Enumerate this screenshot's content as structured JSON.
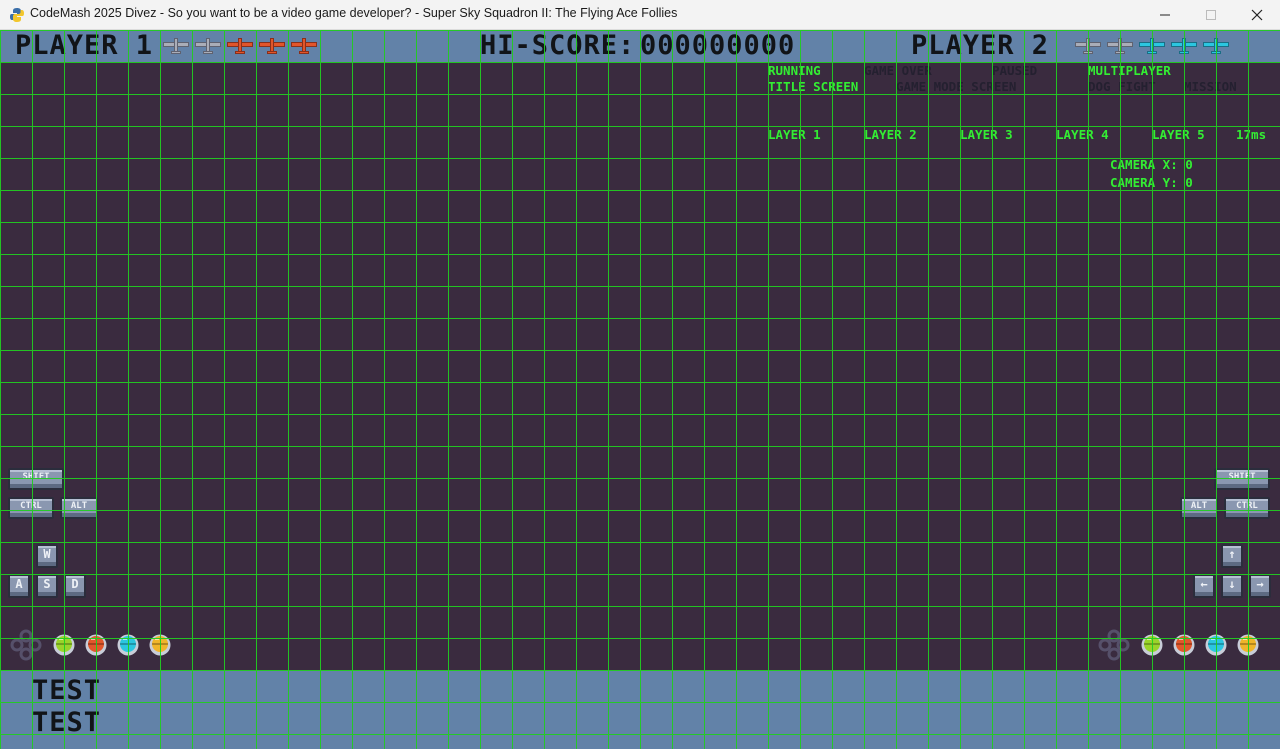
{
  "window": {
    "title": "CodeMash 2025 Divez - So you want to be a video game developer? - Super Sky Squadron II: The Flying Ace Follies"
  },
  "hud": {
    "player1_label": "PLAYER 1",
    "hiscore_label": "HI-SCORE:",
    "hiscore_value": "000000000",
    "player2_label": "PLAYER 2",
    "player1_lives": [
      "gray",
      "gray",
      "red",
      "red",
      "red"
    ],
    "player2_lives": [
      "gray",
      "gray",
      "cyan",
      "cyan",
      "cyan"
    ]
  },
  "debug": {
    "states": [
      {
        "label": "RUNNING",
        "active": true
      },
      {
        "label": "GAME OVER",
        "active": false
      },
      {
        "label": "PAUSED",
        "active": false
      },
      {
        "label": "MULTIPLAYER",
        "active": true
      }
    ],
    "screens": [
      {
        "label": "TITLE SCREEN",
        "active": true
      },
      {
        "label": "GAME MODE SCREEN",
        "active": false
      },
      {
        "label": "DOG FIGHT",
        "active": false
      },
      {
        "label": "MISSION",
        "active": false
      }
    ],
    "layers": [
      "LAYER 1",
      "LAYER 2",
      "LAYER 3",
      "LAYER 4",
      "LAYER 5"
    ],
    "frame_time": "17ms",
    "camera_x": "CAMERA X: 0",
    "camera_y": "CAMERA Y: 0"
  },
  "controls": {
    "p1": {
      "shift": "SHIFT",
      "ctrl": "CTRL",
      "alt": "ALT",
      "up": "W",
      "left": "A",
      "down": "S",
      "right": "D"
    },
    "p2": {
      "shift": "SHIFT",
      "ctrl": "CTRL",
      "alt": "ALT",
      "up": "↑",
      "left": "←",
      "down": "↓",
      "right": "→"
    },
    "button_colors": [
      "#9ad42a",
      "#e2572b",
      "#2bc6e0",
      "#f0b52a"
    ]
  },
  "footer": {
    "line1": "TEST",
    "line2": "TEST"
  },
  "colors": {
    "background": "#3a2b3f",
    "hud": "#6282a8",
    "grid": "#22cc22",
    "debug_active": "#33ee33"
  }
}
